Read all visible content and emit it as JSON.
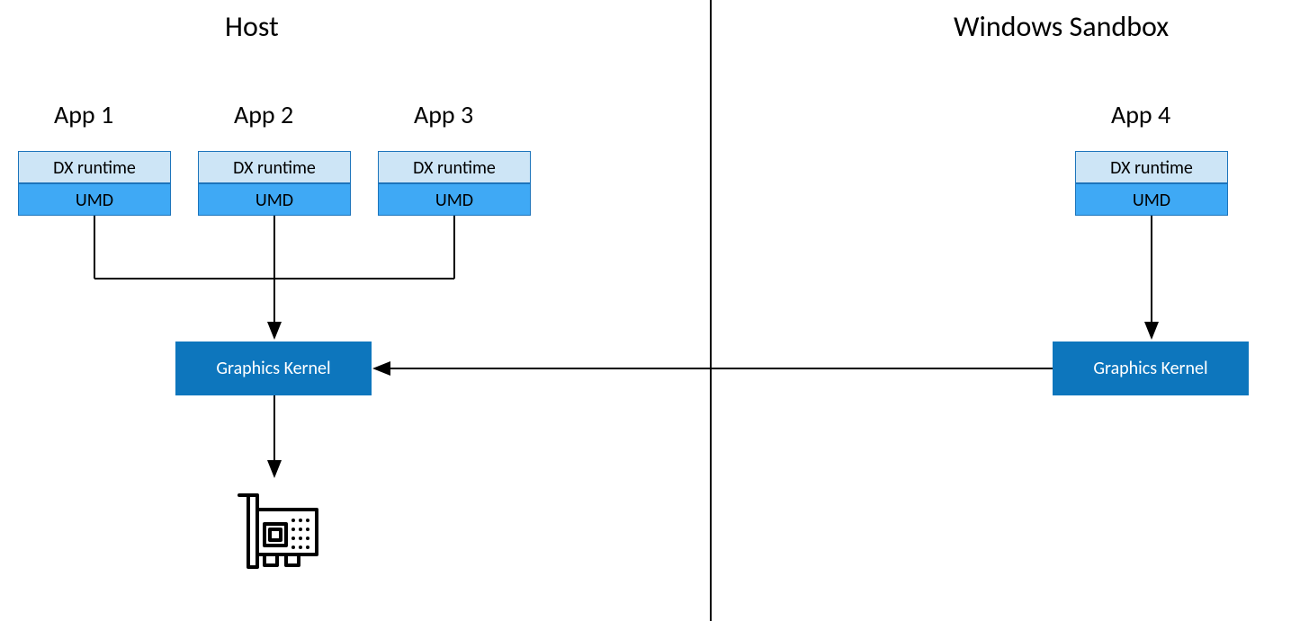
{
  "diagram": {
    "host": {
      "title": "Host",
      "apps": [
        {
          "title": "App 1",
          "dx": "DX runtime",
          "umd": "UMD"
        },
        {
          "title": "App 2",
          "dx": "DX runtime",
          "umd": "UMD"
        },
        {
          "title": "App 3",
          "dx": "DX runtime",
          "umd": "UMD"
        }
      ],
      "kernel": "Graphics Kernel"
    },
    "sandbox": {
      "title": "Windows Sandbox",
      "app": {
        "title": "App 4",
        "dx": "DX runtime",
        "umd": "UMD"
      },
      "kernel": "Graphics Kernel"
    }
  }
}
